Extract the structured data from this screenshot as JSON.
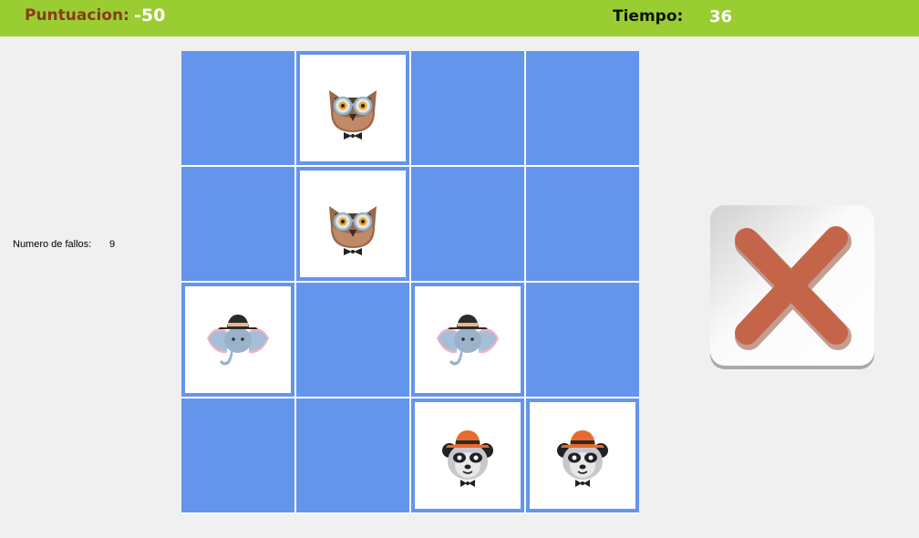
{
  "header": {
    "score_label": "Puntuacion:",
    "score_value": "-50",
    "time_label": "Tiempo:",
    "time_value": "36"
  },
  "side": {
    "fails_label": "Numero de fallos:",
    "fails_value": "9"
  },
  "colors": {
    "header_bg": "#9acd32",
    "score_label": "#8b3a1a",
    "card_back": "#6495ed",
    "cancel_x": "#c4654a"
  },
  "board": {
    "rows": 4,
    "cols": 4,
    "cells": [
      [
        "hidden",
        "owl-icon",
        "hidden",
        "hidden"
      ],
      [
        "hidden",
        "owl-icon",
        "hidden",
        "hidden"
      ],
      [
        "elephant-icon",
        "hidden",
        "elephant-icon",
        "hidden"
      ],
      [
        "hidden",
        "hidden",
        "panda-icon",
        "panda-icon"
      ]
    ]
  },
  "cancel_icon": "close-icon"
}
